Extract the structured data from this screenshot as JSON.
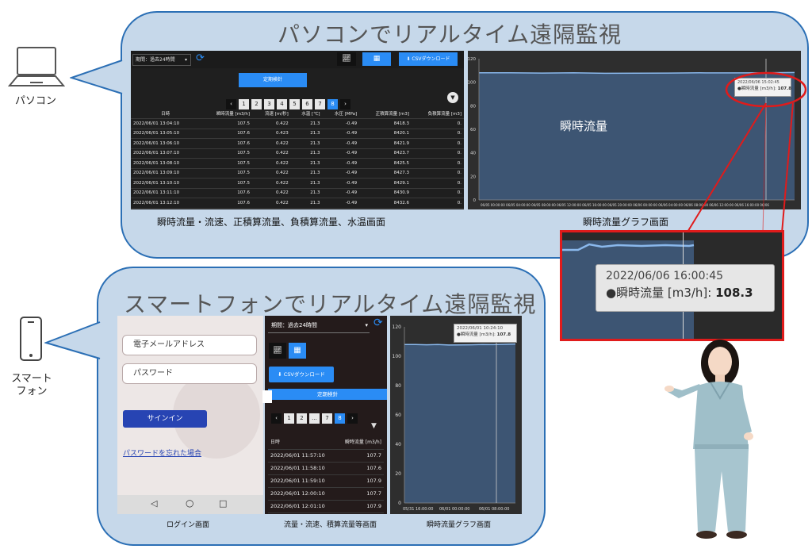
{
  "pc": {
    "title": "パソコンでリアルタイム遠隔監視",
    "device_label": "パソコン",
    "toolbar": {
      "period": "期間：過去24時間",
      "csv_button": "CSVダウンロード"
    },
    "tab_label": "定期検針",
    "pager": [
      "1",
      "2",
      "3",
      "4",
      "5",
      "6",
      "7",
      "8"
    ],
    "pager_active": "8",
    "table": {
      "headers": [
        "日時",
        "瞬時流量 [m3/h]",
        "流速 [m/秒]",
        "水温 [℃]",
        "水圧 [MPa]",
        "正積算流量 [m3]",
        "負積算流量 [m3]"
      ],
      "rows": [
        [
          "2022/06/01 13:04:10",
          "107.5",
          "0.422",
          "21.3",
          "-0.49",
          "8418.3",
          "0."
        ],
        [
          "2022/06/01 13:05:10",
          "107.6",
          "0.423",
          "21.3",
          "-0.49",
          "8420.1",
          "0."
        ],
        [
          "2022/06/01 13:06:10",
          "107.6",
          "0.422",
          "21.3",
          "-0.49",
          "8421.9",
          "0."
        ],
        [
          "2022/06/01 13:07:10",
          "107.5",
          "0.422",
          "21.3",
          "-0.49",
          "8423.7",
          "0."
        ],
        [
          "2022/06/01 13:08:10",
          "107.5",
          "0.422",
          "21.3",
          "-0.49",
          "8425.5",
          "0."
        ],
        [
          "2022/06/01 13:09:10",
          "107.5",
          "0.422",
          "21.3",
          "-0.49",
          "8427.3",
          "0."
        ],
        [
          "2022/06/01 13:10:10",
          "107.5",
          "0.422",
          "21.3",
          "-0.49",
          "8429.1",
          "0."
        ],
        [
          "2022/06/01 13:11:10",
          "107.6",
          "0.422",
          "21.3",
          "-0.49",
          "8430.9",
          "0."
        ],
        [
          "2022/06/01 13:12:10",
          "107.6",
          "0.422",
          "21.3",
          "-0.49",
          "8432.6",
          "0."
        ]
      ]
    },
    "caption_table": "瞬時流量・流速、正積算流量、負積算流量、水温画面",
    "caption_graph": "瞬時流量グラフ画面",
    "graph": {
      "overlay_label": "瞬時流量",
      "yticks": [
        "120",
        "100",
        "80",
        "60",
        "40",
        "20",
        "0"
      ],
      "xticks": "06/05 00:00:00 06/05 04:00:00 06/05 08:00:00 06/05 12:00:00 06/05 16:00:00 06/05 20:00:00 06/06 00:00:00 06/06 04:00:00 06/06 08:00:00 06/06 12:00:00 06/06 16:00:00 06/06",
      "tooltip_time": "2022/06/06 15:02:45",
      "tooltip_label": "●瞬時流量 [m3/h]:",
      "tooltip_value": "107.8"
    },
    "zoom": {
      "time": "2022/06/06 16:00:45",
      "label": "●瞬時流量 [m3/h]:",
      "value": "108.3"
    }
  },
  "phone": {
    "title": "スマートフォンでリアルタイム遠隔監視",
    "device_label": "スマート\nフォン",
    "login": {
      "email_placeholder": "電子メールアドレス",
      "password_placeholder": "パスワード",
      "signin_button": "サインイン",
      "forgot_link": "パスワードを忘れた場合",
      "caption": "ログイン画面"
    },
    "table_screen": {
      "period": "期間：過去24時間",
      "csv_button": "CSVダウンロード",
      "tab_label": "定期検針",
      "pager": [
        "1",
        "2",
        "...",
        "7",
        "8"
      ],
      "pager_active": "8",
      "headers": [
        "日時",
        "瞬時流量 [m3/h]"
      ],
      "rows": [
        [
          "2022/06/01 11:57:10",
          "107.7"
        ],
        [
          "2022/06/01 11:58:10",
          "107.6"
        ],
        [
          "2022/06/01 11:59:10",
          "107.9"
        ],
        [
          "2022/06/01 12:00:10",
          "107.7"
        ],
        [
          "2022/06/01 12:01:10",
          "107.9"
        ],
        [
          "2022/06/01 12:02:10",
          "107.8"
        ]
      ],
      "caption": "流量・流速、積算流量等画面"
    },
    "graph": {
      "yticks": [
        "120",
        "100",
        "80",
        "60",
        "40",
        "20",
        "0"
      ],
      "xticks": [
        "05/31 16:00:00",
        "06/01 00:00:00",
        "06/01 08:00:00"
      ],
      "tooltip_time": "2022/06/01 10:24:10",
      "tooltip_label": "●瞬時流量 [m3/h]:",
      "tooltip_value": "107.8",
      "caption": "瞬時流量グラフ画面"
    }
  },
  "chart_data": {
    "type": "line",
    "series": [
      {
        "name": "瞬時流量",
        "values": [
          108,
          108,
          107.8,
          108,
          107.6,
          107.7,
          107.8,
          108,
          107.9,
          108.1,
          108.3
        ]
      }
    ],
    "ylim": [
      0,
      120
    ]
  }
}
